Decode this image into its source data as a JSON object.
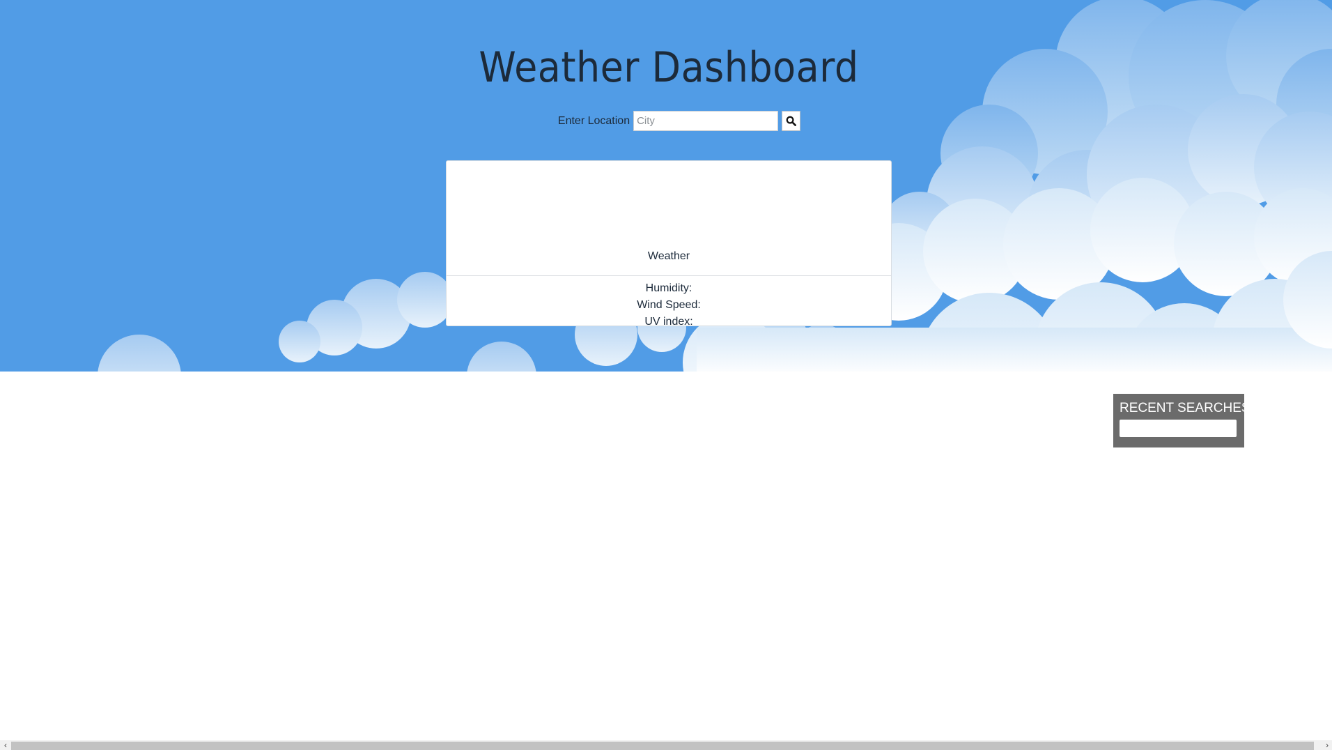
{
  "header": {
    "title": "Weather Dashboard",
    "search_label": "Enter Location",
    "search_placeholder": "City",
    "search_value": ""
  },
  "card": {
    "weather_label": "Weather",
    "humidity_label": "Humidity:",
    "wind_label": "Wind Speed:",
    "uv_label": "UV index:"
  },
  "recent": {
    "title": "RECENT SEARCHES"
  },
  "icons": {
    "search": "search-icon",
    "scroll_left": "chevron-left-icon",
    "scroll_right": "chevron-right-icon"
  },
  "colors": {
    "sky": "#519ce6",
    "recent_panel": "#6b6b6b"
  }
}
